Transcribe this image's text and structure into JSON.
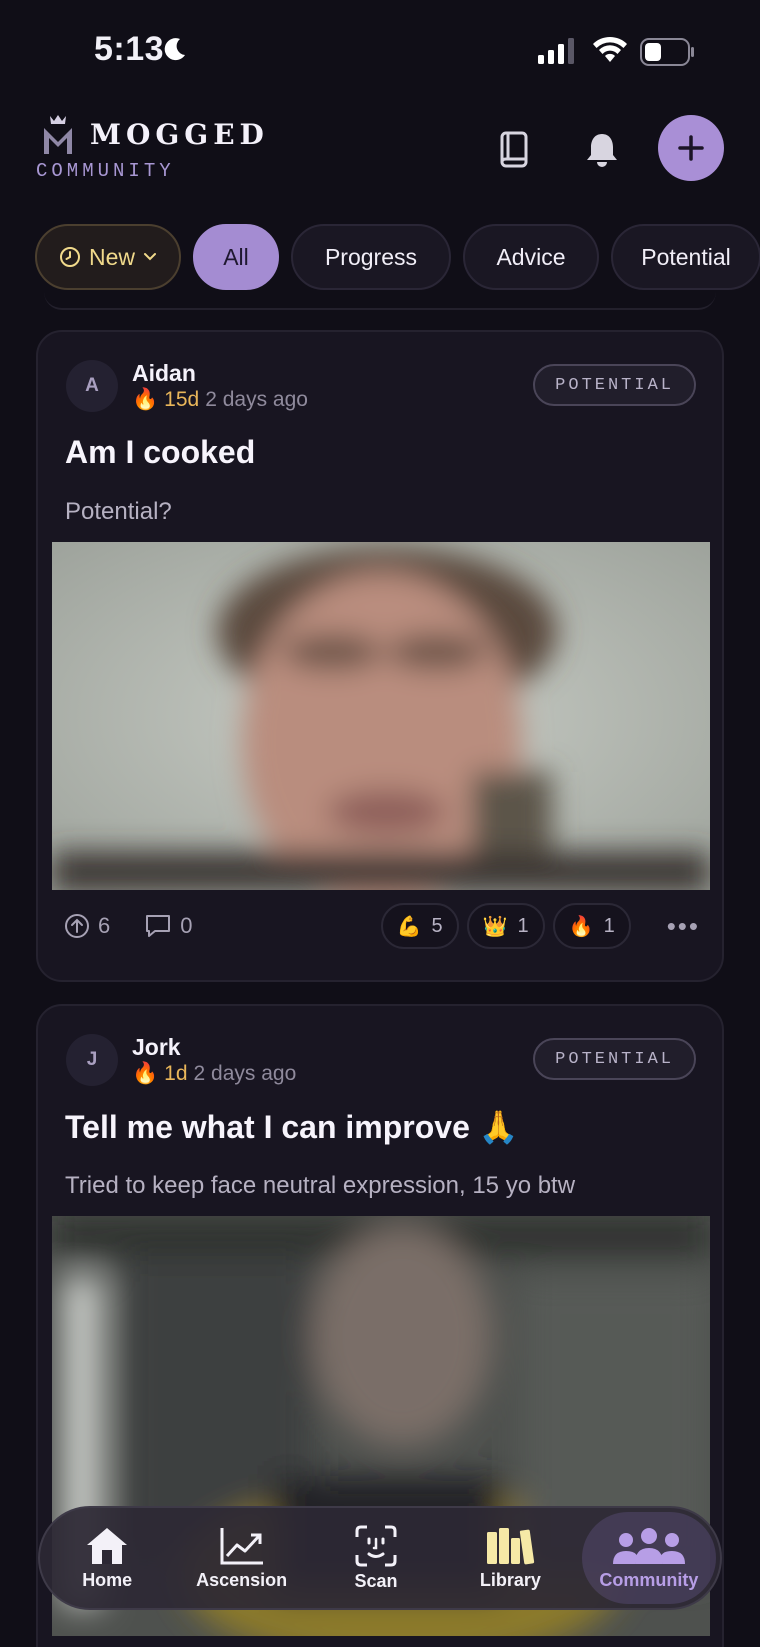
{
  "status_bar": {
    "time": "5:13"
  },
  "header": {
    "logo_text": "MOGGED",
    "logo_subtitle": "COMMUNITY",
    "icons": [
      "book-icon",
      "bell-icon",
      "plus-icon"
    ]
  },
  "filters": {
    "sort_label": "New",
    "chips": [
      "All",
      "Progress",
      "Advice",
      "Potential"
    ]
  },
  "posts": [
    {
      "avatar": "A",
      "author": "Aidan",
      "streak": "15d",
      "time": "2 days ago",
      "tag": "POTENTIAL",
      "title": "Am I cooked",
      "body": "Potential?",
      "upvotes": "6",
      "comments": "0",
      "reactions": [
        {
          "emoji": "💪",
          "count": "5"
        },
        {
          "emoji": "👑",
          "count": "1"
        },
        {
          "emoji": "🔥",
          "count": "1"
        }
      ],
      "more": "•••"
    },
    {
      "avatar": "J",
      "author": "Jork",
      "streak": "1d",
      "time": "2 days ago",
      "tag": "POTENTIAL",
      "title": "Tell me what I can improve 🙏",
      "body": "Tried to keep face neutral expression, 15 yo btw"
    }
  ],
  "tabbar": {
    "active": "Community",
    "tabs": [
      {
        "label": "Home",
        "icon": "home-icon"
      },
      {
        "label": "Ascension",
        "icon": "chart-icon"
      },
      {
        "label": "Scan",
        "icon": "face-scan-icon"
      },
      {
        "label": "Library",
        "icon": "library-icon"
      },
      {
        "label": "Community",
        "icon": "community-icon"
      }
    ]
  },
  "colors": {
    "background": "#100e17",
    "accent": "#a48cd2",
    "streak": "#e9b65a",
    "card": "#181521"
  }
}
